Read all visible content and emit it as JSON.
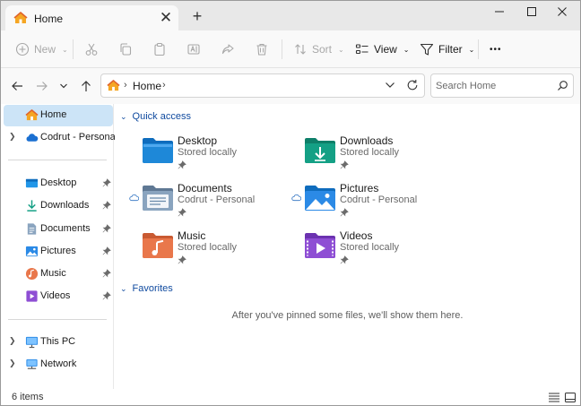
{
  "tab": {
    "title": "Home",
    "close_glyph": "✕",
    "new_tab_glyph": "+"
  },
  "window_controls": {
    "minimize": "—",
    "maximize": "☐",
    "close": "✕"
  },
  "toolbar": {
    "new_label": "New",
    "sort_label": "Sort",
    "view_label": "View",
    "filter_label": "Filter",
    "more_glyph": "•••"
  },
  "address": {
    "path": "Home",
    "separator": "›"
  },
  "search": {
    "placeholder": "Search Home"
  },
  "sidebar": {
    "home": "Home",
    "onedrive": "Codrut - Personal",
    "pinned": [
      "Desktop",
      "Downloads",
      "Documents",
      "Pictures",
      "Music",
      "Videos"
    ],
    "this_pc": "This PC",
    "network": "Network"
  },
  "quick_access": {
    "title": "Quick access",
    "items": [
      {
        "name": "Desktop",
        "location": "Stored locally",
        "icon": "desktop-folder-icon",
        "cloud": false
      },
      {
        "name": "Downloads",
        "location": "Stored locally",
        "icon": "downloads-folder-icon",
        "cloud": false
      },
      {
        "name": "Documents",
        "location": "Codrut - Personal",
        "icon": "documents-folder-icon",
        "cloud": true
      },
      {
        "name": "Pictures",
        "location": "Codrut - Personal",
        "icon": "pictures-folder-icon",
        "cloud": true
      },
      {
        "name": "Music",
        "location": "Stored locally",
        "icon": "music-folder-icon",
        "cloud": false
      },
      {
        "name": "Videos",
        "location": "Stored locally",
        "icon": "videos-folder-icon",
        "cloud": false
      }
    ]
  },
  "favorites": {
    "title": "Favorites",
    "empty_message": "After you've pinned some files, we'll show them here."
  },
  "status": {
    "item_count": "6 items"
  },
  "colors": {
    "accent": "#0f4a9f",
    "selection": "#cce4f7",
    "folder_blue": "#1e88d8",
    "folder_teal": "#14a085",
    "folder_orange": "#e9774b",
    "folder_purple": "#8e4ed4",
    "cloud_blue": "#2a6fc0"
  }
}
